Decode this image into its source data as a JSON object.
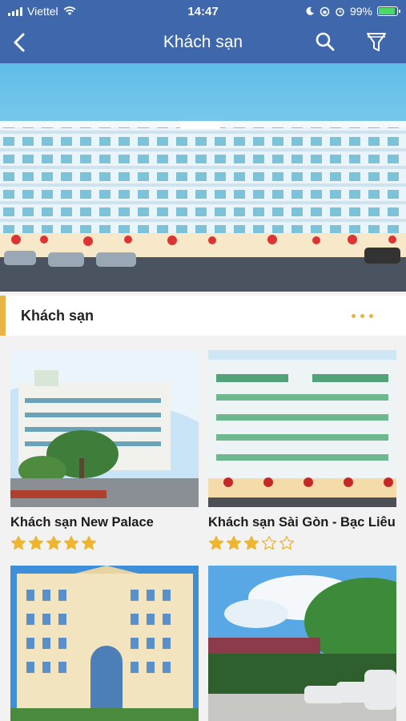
{
  "status_bar": {
    "carrier": "Viettel",
    "time": "14:47",
    "battery": "99%"
  },
  "nav": {
    "title": "Khách sạn",
    "back_icon": "chevron-left-icon",
    "search_icon": "search-icon",
    "filter_icon": "filter-icon"
  },
  "section": {
    "title": "Khách sạn",
    "more_icon": "more-dots-icon"
  },
  "hotels": [
    {
      "name": "Khách sạn New Palace",
      "rating": 5
    },
    {
      "name": "Khách sạn Sài Gòn - Bạc Liêu",
      "rating": 3
    },
    {
      "name": "",
      "rating": 0
    },
    {
      "name": "",
      "rating": 0
    }
  ],
  "colors": {
    "header": "#3e68ab",
    "accent": "#e8b446",
    "star_filled": "#f0b52e",
    "star_empty": "#f0b52e"
  }
}
